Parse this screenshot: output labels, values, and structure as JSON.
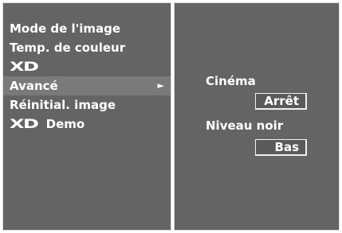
{
  "menu": {
    "items": [
      {
        "label": "Mode de l'image"
      },
      {
        "label": "Temp. de couleur"
      },
      {
        "logo": "XD",
        "label": ""
      },
      {
        "label": "Avancé",
        "arrow": "►"
      },
      {
        "label": "Réinitial. image"
      },
      {
        "logo": "XD",
        "label": "Demo"
      }
    ],
    "selected_index": 3
  },
  "submenu": {
    "cinema_label": "Cinéma",
    "cinema_value": "Arrêt",
    "black_level_label": "Niveau noir",
    "black_level_value": "Bas"
  },
  "colors": {
    "panel_bg": "#646464",
    "highlight": "#7a7a7a",
    "text": "#ffffff"
  }
}
